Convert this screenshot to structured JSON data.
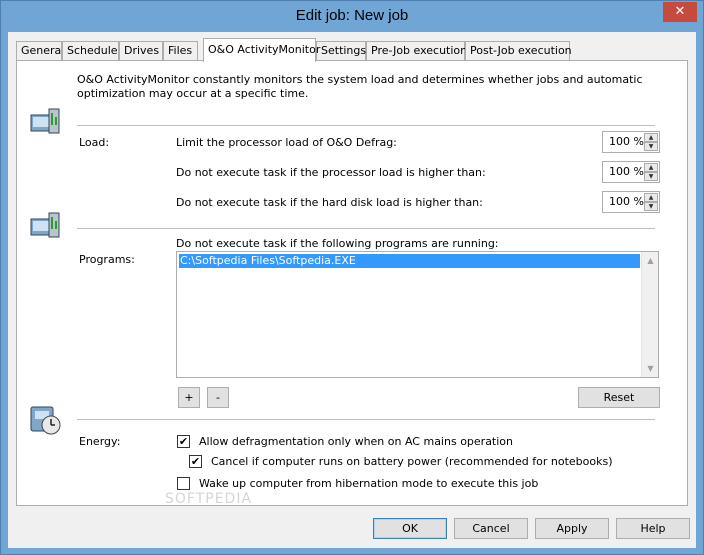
{
  "window": {
    "title": "Edit job: New job",
    "close_glyph": "✕"
  },
  "tabs": [
    {
      "label": "General"
    },
    {
      "label": "Schedule"
    },
    {
      "label": "Drives"
    },
    {
      "label": "Files"
    },
    {
      "label": "O&O ActivityMonitor",
      "active": true
    },
    {
      "label": "Settings"
    },
    {
      "label": "Pre-Job execution"
    },
    {
      "label": "Post-Job execution"
    }
  ],
  "intro": "O&O ActivityMonitor constantly monitors the system load and determines whether jobs and automatic optimization may occur at a specific time.",
  "load": {
    "label": "Load:",
    "rows": [
      {
        "text": "Limit the processor load of O&O Defrag:",
        "value": "100 %"
      },
      {
        "text": "Do not execute task if the processor load is higher than:",
        "value": "100 %"
      },
      {
        "text": "Do not execute task if the hard disk load is higher than:",
        "value": "100 %"
      }
    ]
  },
  "programs": {
    "heading": "Do not execute task if the following programs are running:",
    "label": "Programs:",
    "items": [
      "C:\\Softpedia Files\\Softpedia.EXE"
    ],
    "add_label": "+",
    "remove_label": "-",
    "reset_label": "Reset"
  },
  "energy": {
    "label": "Energy:",
    "options": [
      {
        "text": "Allow defragmentation only when on AC mains operation",
        "checked": true
      },
      {
        "text": "Cancel if computer runs on battery power (recommended for notebooks)",
        "checked": true
      },
      {
        "text": "Wake up computer from hibernation mode to execute this job",
        "checked": false
      }
    ]
  },
  "watermark": "SOFTPEDIA",
  "buttons": {
    "ok": "OK",
    "cancel": "Cancel",
    "apply": "Apply",
    "help": "Help"
  },
  "icons": {
    "check": "✔",
    "up": "▲",
    "down": "▼"
  }
}
